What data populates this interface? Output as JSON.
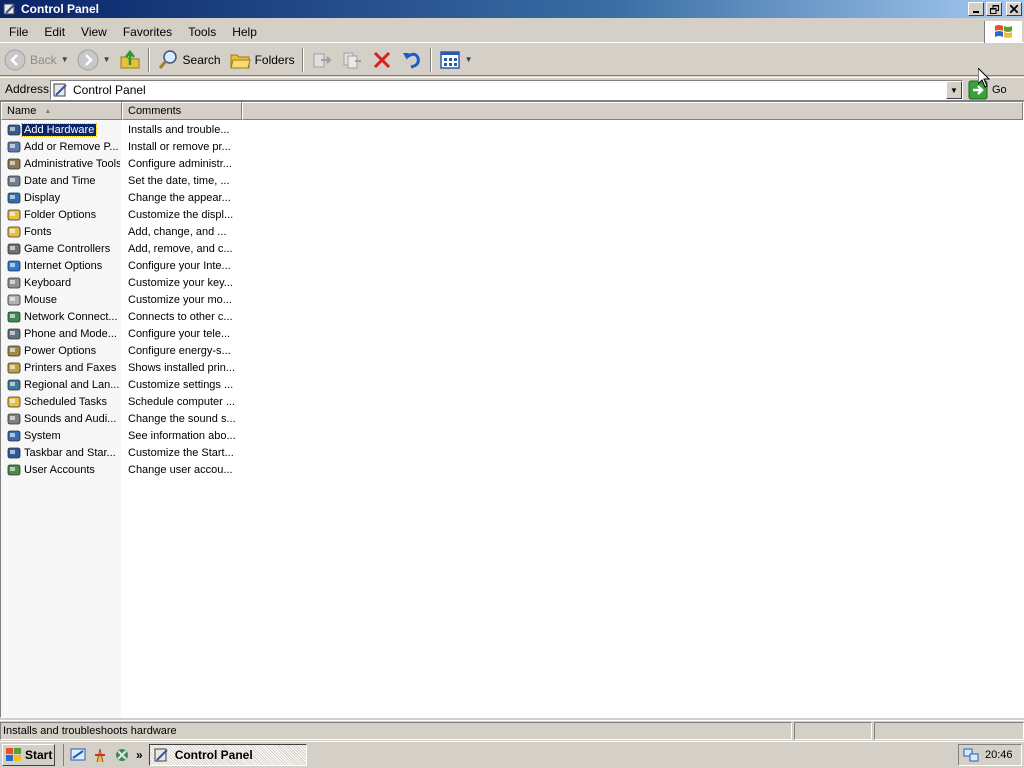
{
  "window": {
    "title": "Control Panel",
    "controls": {
      "minimize": "_",
      "restore": "▫",
      "close": "✕"
    }
  },
  "menu": {
    "items": [
      {
        "label": "File",
        "key": "F",
        "rest": "ile"
      },
      {
        "label": "Edit",
        "key": "E",
        "rest": "dit"
      },
      {
        "label": "View",
        "key": "V",
        "rest": "iew"
      },
      {
        "label": "Favorites",
        "key": "F",
        "rest": "avorites",
        "pre": ""
      },
      {
        "label": "Tools",
        "key": "T",
        "rest": "ools"
      },
      {
        "label": "Help",
        "key": "H",
        "rest": "elp"
      }
    ]
  },
  "toolbar": {
    "back_label": "Back",
    "search_label": "Search",
    "folders_label": "Folders"
  },
  "address": {
    "label": "Address",
    "value": "Control Panel",
    "go_label": "Go"
  },
  "columns": {
    "name": "Name",
    "comments": "Comments"
  },
  "items": [
    {
      "name": "Add Hardware",
      "comment": "Installs and trouble...",
      "icon": "add-hardware-icon",
      "color": "#3a5a8c"
    },
    {
      "name": "Add or Remove P...",
      "comment": "Install or remove pr...",
      "icon": "add-remove-programs-icon",
      "color": "#5a7ab0"
    },
    {
      "name": "Administrative Tools",
      "comment": "Configure administr...",
      "icon": "administrative-tools-icon",
      "color": "#8c7a50"
    },
    {
      "name": "Date and Time",
      "comment": "Set the date, time, ...",
      "icon": "date-time-icon",
      "color": "#708090"
    },
    {
      "name": "Display",
      "comment": "Change the appear...",
      "icon": "display-icon",
      "color": "#2f6fb0"
    },
    {
      "name": "Folder Options",
      "comment": "Customize the displ...",
      "icon": "folder-options-icon",
      "color": "#e8c040"
    },
    {
      "name": "Fonts",
      "comment": "Add, change, and ...",
      "icon": "fonts-icon",
      "color": "#e8c040"
    },
    {
      "name": "Game Controllers",
      "comment": "Add, remove, and c...",
      "icon": "game-controllers-icon",
      "color": "#707070"
    },
    {
      "name": "Internet Options",
      "comment": "Configure your Inte...",
      "icon": "internet-options-icon",
      "color": "#2a7ad0"
    },
    {
      "name": "Keyboard",
      "comment": "Customize your key...",
      "icon": "keyboard-icon",
      "color": "#909090"
    },
    {
      "name": "Mouse",
      "comment": "Customize your mo...",
      "icon": "mouse-icon",
      "color": "#b0b0b0"
    },
    {
      "name": "Network Connect...",
      "comment": "Connects to other c...",
      "icon": "network-connections-icon",
      "color": "#3a8a5a"
    },
    {
      "name": "Phone and Mode...",
      "comment": "Configure your tele...",
      "icon": "phone-modem-icon",
      "color": "#607080"
    },
    {
      "name": "Power Options",
      "comment": "Configure energy-s...",
      "icon": "power-options-icon",
      "color": "#a08a40"
    },
    {
      "name": "Printers and Faxes",
      "comment": "Shows installed prin...",
      "icon": "printers-faxes-icon",
      "color": "#c0a040"
    },
    {
      "name": "Regional and Lan...",
      "comment": "Customize settings ...",
      "icon": "regional-language-icon",
      "color": "#3a7a9a"
    },
    {
      "name": "Scheduled Tasks",
      "comment": "Schedule computer ...",
      "icon": "scheduled-tasks-icon",
      "color": "#e8c040"
    },
    {
      "name": "Sounds and Audi...",
      "comment": "Change the sound s...",
      "icon": "sounds-audio-icon",
      "color": "#808080"
    },
    {
      "name": "System",
      "comment": "See information abo...",
      "icon": "system-icon",
      "color": "#3a6ab0"
    },
    {
      "name": "Taskbar and Star...",
      "comment": "Customize the Start...",
      "icon": "taskbar-start-icon",
      "color": "#2a5a9a"
    },
    {
      "name": "User Accounts",
      "comment": "Change user accou...",
      "icon": "user-accounts-icon",
      "color": "#4a8a4a"
    }
  ],
  "status": {
    "text": "Installs and troubleshoots hardware"
  },
  "taskbar": {
    "start_label": "Start",
    "task_label": "Control Panel",
    "clock": "20:46",
    "quicklaunch_more": "»"
  }
}
